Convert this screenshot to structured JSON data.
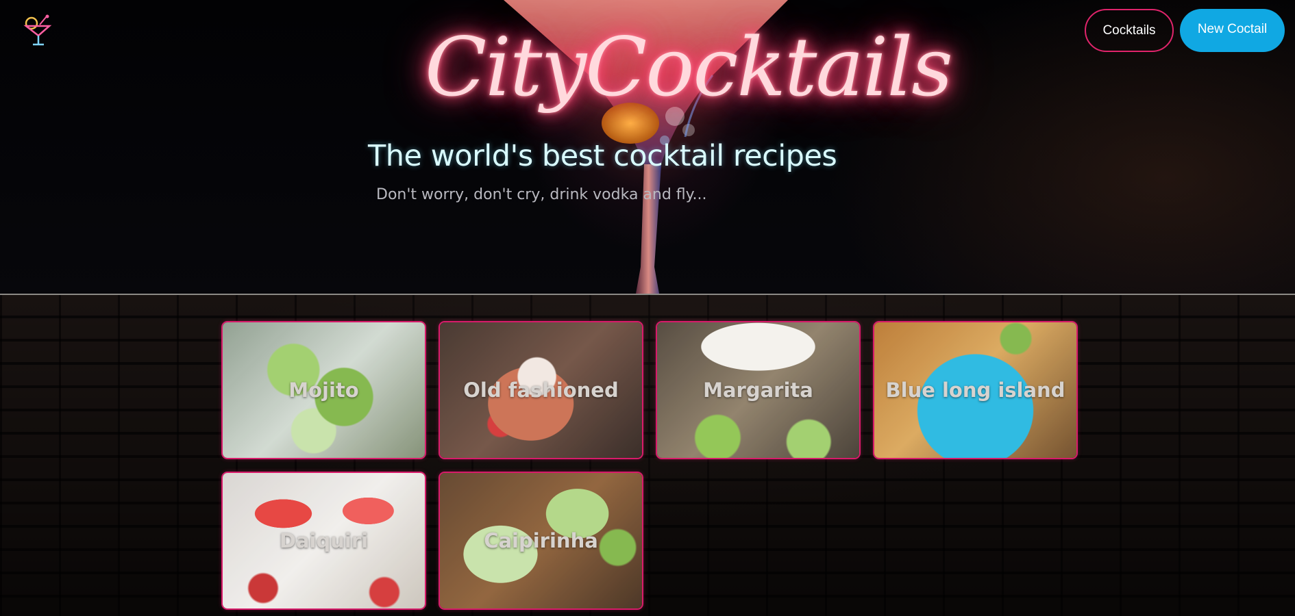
{
  "header": {
    "brand": "CityCocktails",
    "headline": "The world's best cocktail recipes",
    "tagline": "Don't worry, don't cry, drink vodka and fly...",
    "nav": {
      "cocktails_label": "Cocktails",
      "new_label": "New Coctail"
    }
  },
  "cocktails": [
    {
      "name": "Mojito"
    },
    {
      "name": "Old fashioned"
    },
    {
      "name": "Margarita"
    },
    {
      "name": "Blue long island"
    },
    {
      "name": "Daiquiri"
    },
    {
      "name": "Caipirinha"
    }
  ],
  "colors": {
    "accent_pink": "#d81b6a",
    "accent_blue": "#10a8e3",
    "neon_glow": "#ff4f7a"
  },
  "icons": {
    "logo": "cocktail-glass-icon"
  }
}
